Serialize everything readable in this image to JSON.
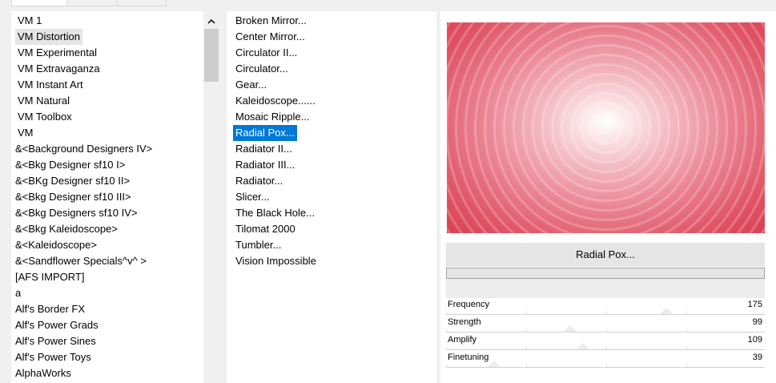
{
  "tabs": [
    "",
    "",
    ""
  ],
  "categories": [
    "VM 1",
    "VM Distortion",
    "VM Experimental",
    "VM Extravaganza",
    "VM Instant Art",
    "VM Natural",
    "VM Toolbox",
    "VM",
    "&<Background Designers IV>",
    "&<Bkg Designer sf10 I>",
    "&<BKg Designer sf10 II>",
    "&<Bkg Designer sf10 III>",
    "&<Bkg Designers sf10 IV>",
    "&<Bkg Kaleidoscope>",
    "&<Kaleidoscope>",
    "&<Sandflower Specials^v^ >",
    "[AFS IMPORT]",
    "a",
    "Alf's Border FX",
    "Alf's Power Grads",
    "Alf's Power Sines",
    "Alf's Power Toys",
    "AlphaWorks"
  ],
  "selected_category": "VM Distortion",
  "filters": [
    "Broken Mirror...",
    "Center Mirror...",
    "Circulator II...",
    "Circulator...",
    "Gear...",
    "Kaleidoscope......",
    "Mosaic Ripple...",
    "Radial Pox...",
    "Radiator II...",
    "Radiator III...",
    "Radiator...",
    "Slicer...",
    "The Black Hole...",
    "Tilomat 2000",
    "Tumbler...",
    "Vision Impossible"
  ],
  "selected_filter": "Radial Pox...",
  "preview": {
    "title": "Radial Pox...",
    "colors": {
      "edge": "#da3f52",
      "center": "#ffffff"
    }
  },
  "params": [
    {
      "name": "Frequency",
      "value": "175",
      "level": 0.69
    },
    {
      "name": "Strength",
      "value": "99",
      "level": 0.39
    },
    {
      "name": "Amplify",
      "value": "109",
      "level": 0.43
    },
    {
      "name": "Finetuning",
      "value": "39",
      "level": 0.15
    }
  ],
  "colors": {
    "selection": "#0078d7",
    "hover": "#e5e5e5"
  }
}
